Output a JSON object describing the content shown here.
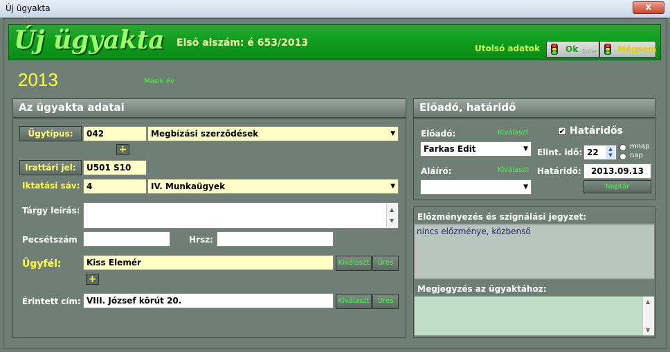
{
  "window": {
    "title": "Új ügyakta",
    "close": "x"
  },
  "header": {
    "title": "Új ügyakta",
    "first_number": "Első alszám: é 653/2013",
    "last_data": "Utolsó adatok",
    "ok_label": "Ok",
    "enter_hint": "Enter",
    "cancel_label": "Mégsem"
  },
  "year": {
    "value": "2013",
    "other": "Másik év"
  },
  "left": {
    "title": "Az ügyakta adatai",
    "case_type": {
      "label": "Ügytípus:",
      "code": "042",
      "name": "Megbízási szerződések"
    },
    "filing": {
      "label": "Irattári jel:",
      "value": "U501 S10"
    },
    "registry": {
      "label": "Iktatási sáv:",
      "code": "4",
      "name": "IV. Munkaügyek"
    },
    "subject": {
      "label": "Tárgy leírás:",
      "value": ""
    },
    "stamp": {
      "label": "Pecsétszám",
      "value": ""
    },
    "hrsz": {
      "label": "Hrsz:",
      "value": ""
    },
    "client": {
      "label": "Ügyfél:",
      "value": "Kiss Elemér",
      "select": "Kiválaszt",
      "clear": "Üres"
    },
    "address": {
      "label": "Érintett cím:",
      "value": "VIII. József körút  20.",
      "select": "Kiválaszt",
      "clear": "Üres"
    },
    "plus": "+"
  },
  "right": {
    "title": "Előadó, határidő",
    "presenter": {
      "label": "Előadó:",
      "select": "Kiválaszt",
      "value": "Farkas Edit"
    },
    "signer": {
      "label": "Aláíró:",
      "select": "Kiválaszt",
      "value": ""
    },
    "deadline_check": "Határidős",
    "time_label": "Elint. idő:",
    "time_value": "22",
    "unit_workday": "mnap",
    "unit_day": "nap",
    "deadline_label": "Határidő:",
    "deadline_value": "2013.09.13",
    "calendar": "Naptár"
  },
  "notes": {
    "history_title": "Előzményezés és szignálási jegyzet:",
    "history_value": "nincs előzménye, közbenső",
    "remark_title": "Megjegyzés az ügyaktához:",
    "remark_value": ""
  },
  "colors": {
    "header_green": "#11a01e",
    "field_yellow": "#ffffc8",
    "panel_gray": "#6f7f76"
  }
}
